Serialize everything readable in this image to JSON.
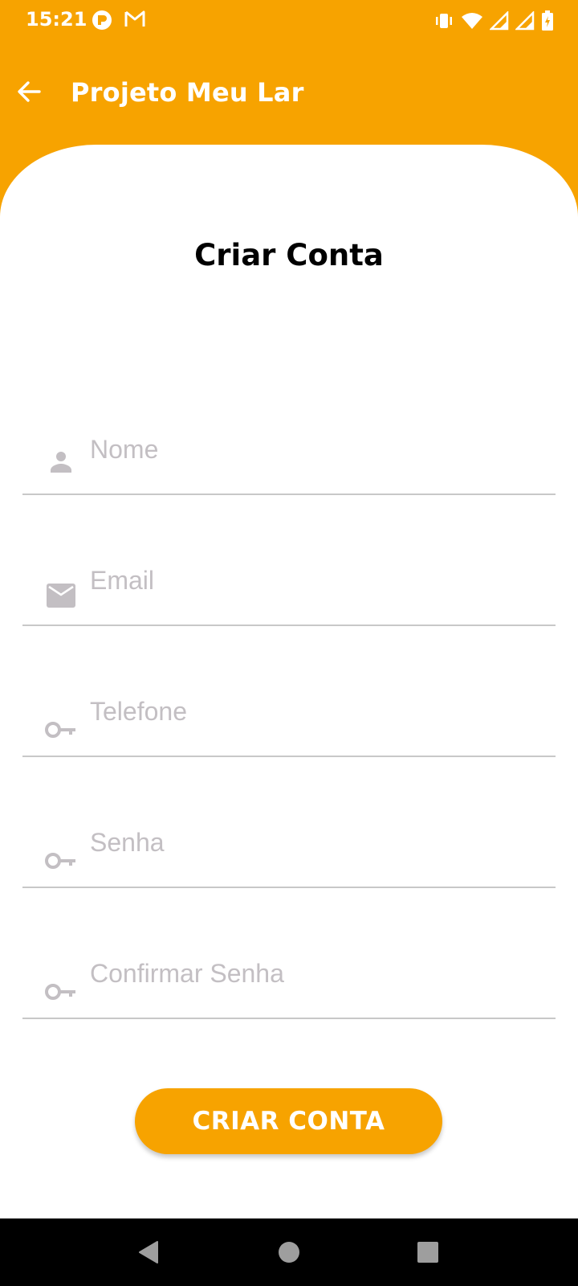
{
  "status_bar": {
    "time": "15:21",
    "left_icons": [
      "app-notification-icon",
      "gmail-icon"
    ],
    "right_icons": [
      "vibrate-icon",
      "wifi-icon",
      "signal-icon",
      "signal-icon",
      "battery-charging-icon"
    ]
  },
  "app_bar": {
    "back_icon": "arrow-back-icon",
    "title": "Projeto Meu Lar"
  },
  "form": {
    "title": "Criar Conta",
    "fields": [
      {
        "icon": "person-icon",
        "placeholder": "Nome",
        "value": ""
      },
      {
        "icon": "mail-icon",
        "placeholder": "Email",
        "value": ""
      },
      {
        "icon": "key-icon",
        "placeholder": "Telefone",
        "value": ""
      },
      {
        "icon": "key-icon",
        "placeholder": "Senha",
        "value": ""
      },
      {
        "icon": "key-icon",
        "placeholder": "Confirmar Senha",
        "value": ""
      }
    ],
    "submit_label": "CRIAR CONTA"
  },
  "nav_bar": {
    "buttons": [
      "back-triangle-icon",
      "home-circle-icon",
      "recents-square-icon"
    ]
  },
  "colors": {
    "accent": "#F7A300",
    "placeholder": "#C3BFC3",
    "icon": "#C3BFC3",
    "underline": "#C8C8C8"
  }
}
